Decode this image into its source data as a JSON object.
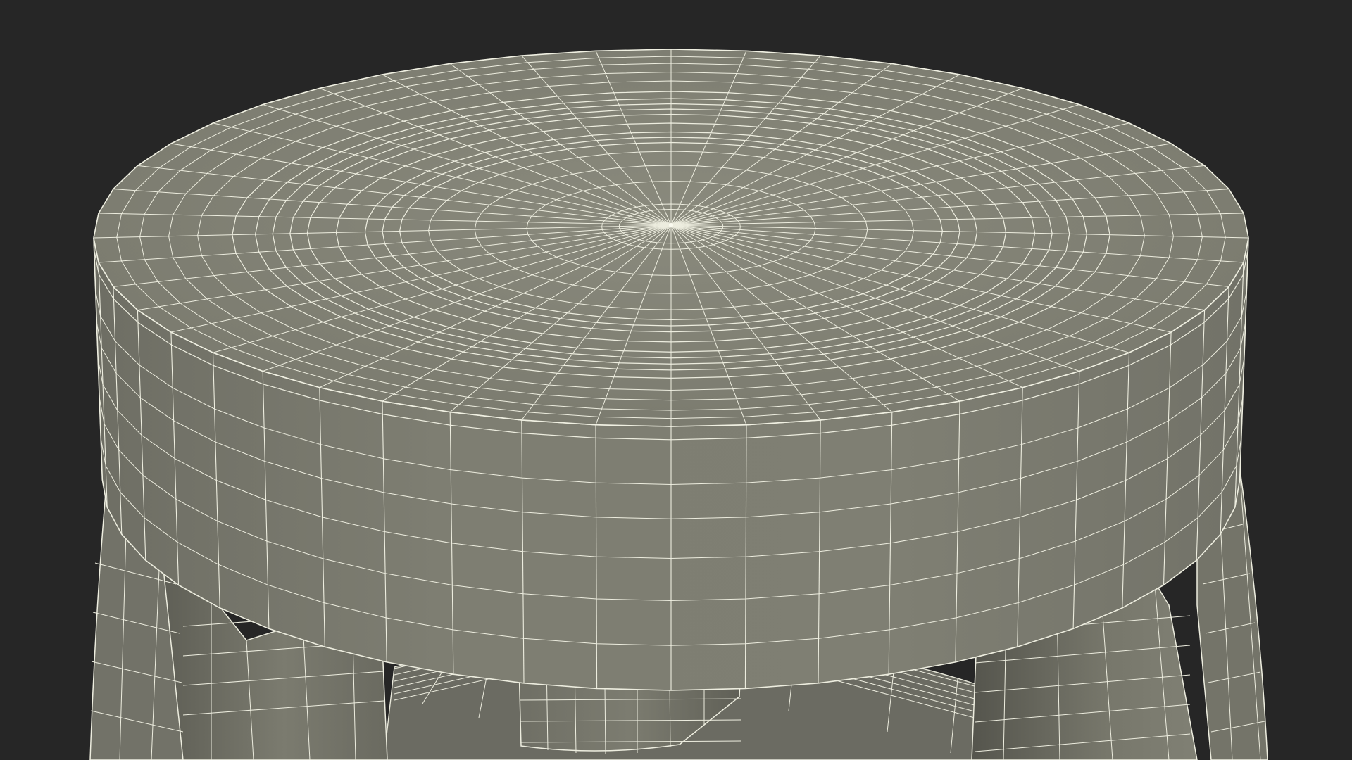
{
  "scene": {
    "subject": "stool-wireframe-render",
    "colors": {
      "background": "#262626",
      "surface": "#7d7d70",
      "surface_dark": "#5d5d54",
      "surface_light": "#8a8a7e",
      "wire": "#ededdf"
    },
    "seat": {
      "top_radial_segments": 48,
      "top_rings": [
        0.09,
        0.12,
        0.25,
        0.34,
        0.42,
        0.47,
        0.5,
        0.53,
        0.58,
        0.63,
        0.66,
        0.69,
        0.72,
        0.76,
        0.82,
        0.87,
        0.92,
        0.96
      ],
      "side_bands": [
        0.22,
        0.35,
        0.5,
        0.66,
        0.83
      ]
    }
  }
}
